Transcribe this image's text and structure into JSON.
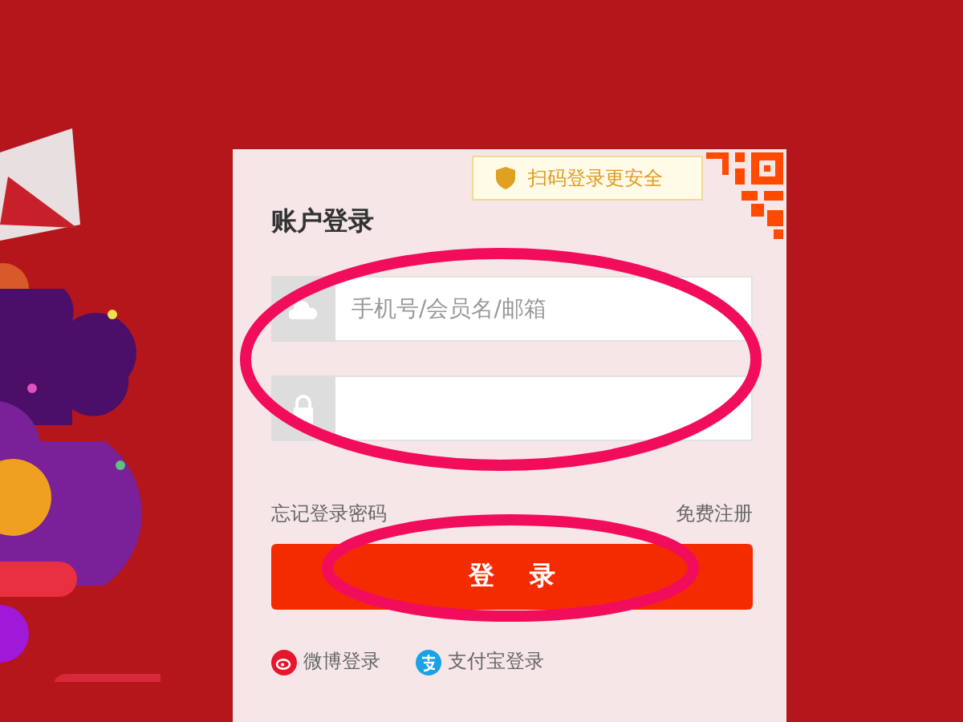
{
  "qr_badge": {
    "text": "扫码登录更安全"
  },
  "title": "账户登录",
  "fields": [
    {
      "kind": "username",
      "placeholder": "手机号/会员名/邮箱"
    },
    {
      "kind": "password"
    }
  ],
  "links": {
    "forgot": "忘记登录密码",
    "register": "免费注册"
  },
  "login_button": "登 录",
  "social": [
    {
      "kind": "weibo",
      "label": "微博登录"
    },
    {
      "kind": "alipay",
      "label": "支付宝登录"
    }
  ]
}
